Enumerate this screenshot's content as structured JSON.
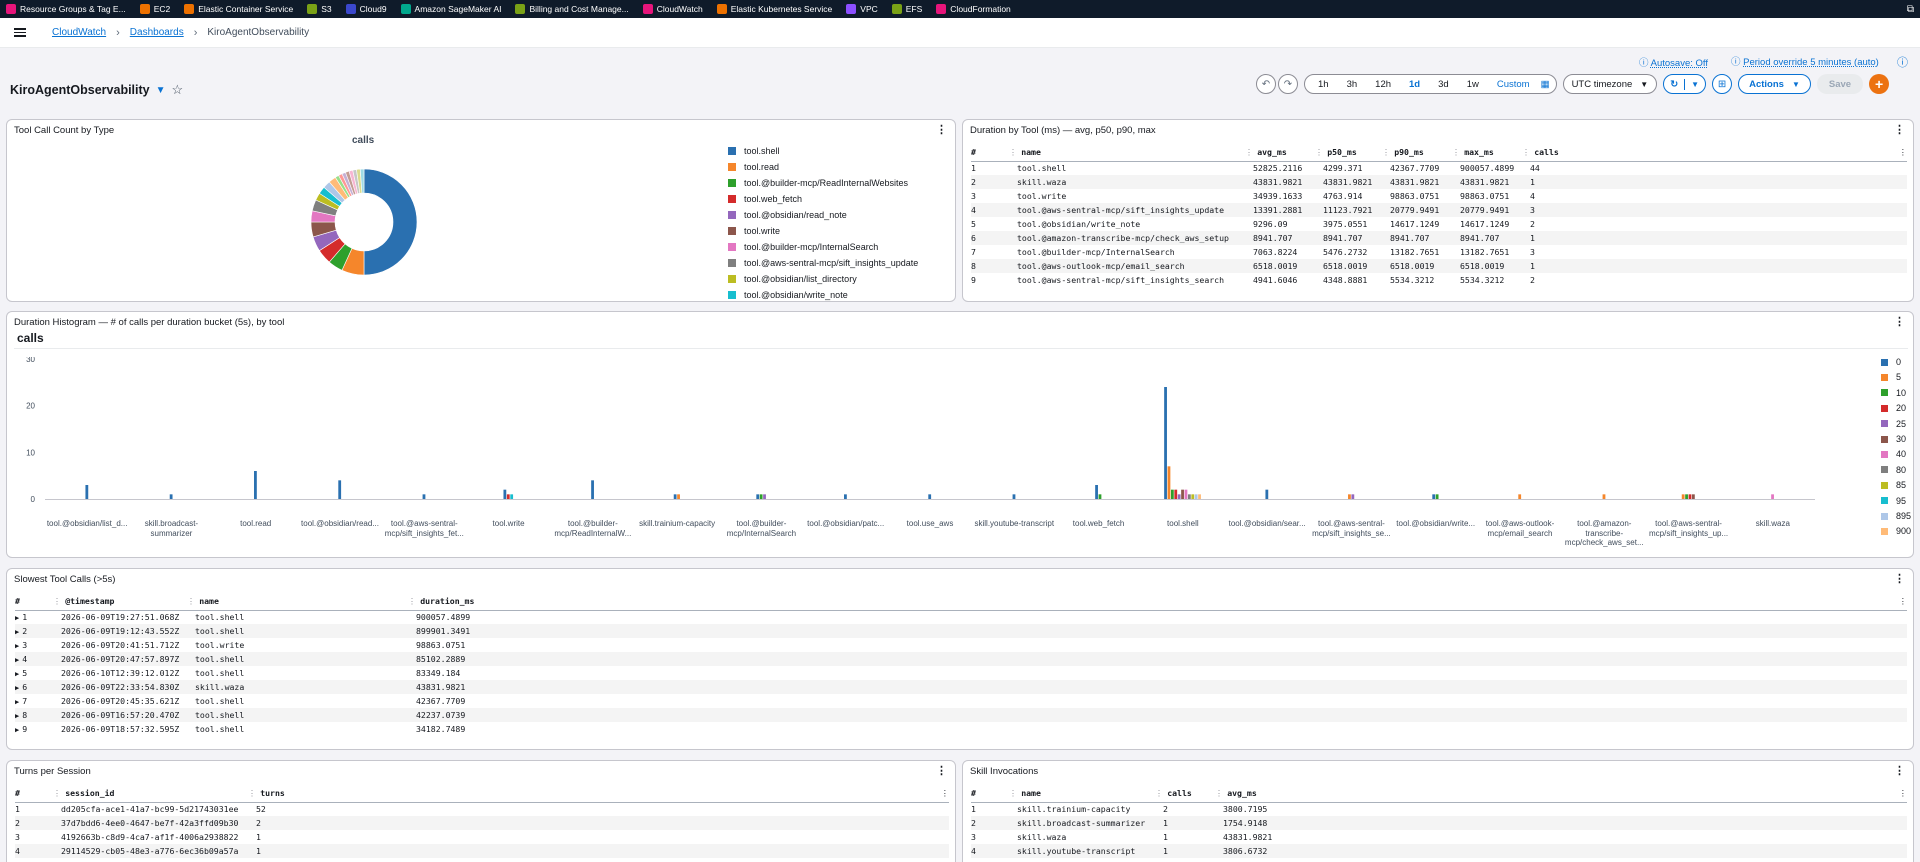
{
  "favorites": [
    {
      "label": "Resource Groups & Tag E...",
      "color": "#e7157b"
    },
    {
      "label": "EC2",
      "color": "#ed7100"
    },
    {
      "label": "Elastic Container Service",
      "color": "#ed7100"
    },
    {
      "label": "S3",
      "color": "#7aa116"
    },
    {
      "label": "Cloud9",
      "color": "#3b48cc"
    },
    {
      "label": "Amazon SageMaker AI",
      "color": "#01a88d"
    },
    {
      "label": "Billing and Cost Manage...",
      "color": "#7aa116"
    },
    {
      "label": "CloudWatch",
      "color": "#e7157b"
    },
    {
      "label": "Elastic Kubernetes Service",
      "color": "#ed7100"
    },
    {
      "label": "VPC",
      "color": "#8c4fff"
    },
    {
      "label": "EFS",
      "color": "#7aa116"
    },
    {
      "label": "CloudFormation",
      "color": "#e7157b"
    }
  ],
  "breadcrumb": {
    "root": "CloudWatch",
    "section": "Dashboards",
    "current": "KiroAgentObservability"
  },
  "top": {
    "autosave": "Autosave: Off",
    "period": "Period override 5 minutes (auto)"
  },
  "dashboard": {
    "title": "KiroAgentObservability"
  },
  "toolbar": {
    "ranges": [
      "1h",
      "3h",
      "12h",
      "1d",
      "3d",
      "1w"
    ],
    "active_range": "1d",
    "custom": "Custom",
    "timezone": "UTC timezone",
    "actions": "Actions",
    "save": "Save"
  },
  "w1": {
    "title": "Tool Call Count by Type",
    "chart_title": "calls"
  },
  "chart_data": [
    {
      "type": "pie",
      "title": "calls",
      "legend": [
        "tool.shell",
        "tool.read",
        "tool.@builder-mcp/ReadInternalWebsites",
        "tool.web_fetch",
        "tool.@obsidian/read_note",
        "tool.write",
        "tool.@builder-mcp/InternalSearch",
        "tool.@aws-sentral-mcp/sift_insights_update",
        "tool.@obsidian/list_directory",
        "tool.@obsidian/write_note"
      ],
      "colors": [
        "#2a70b0",
        "#f5862b",
        "#2ea02c",
        "#d42b2b",
        "#9467bd",
        "#8c564b",
        "#e377c2",
        "#7f7f7f",
        "#bcbd22",
        "#17becf"
      ],
      "extra_colors": [
        "#aec7e8",
        "#ffbb78",
        "#98df8a",
        "#ff9896",
        "#c5b0d5",
        "#c49c94",
        "#f7b6d2",
        "#c7c7c7",
        "#dbdb8d",
        "#9edae5"
      ],
      "values": [
        44,
        6,
        4,
        4,
        4,
        4,
        3,
        3,
        2,
        2
      ],
      "extra_values": [
        2,
        2,
        1,
        1,
        1,
        1,
        1,
        1,
        1,
        1
      ]
    },
    {
      "type": "bar",
      "title": "calls",
      "categories": [
        "tool.@obsidian/list_d...",
        "skill.broadcast-summarizer",
        "tool.read",
        "tool.@obsidian/read...",
        "tool.@aws-sentral-mcp/sift_insights_fet...",
        "tool.write",
        "tool.@builder-mcp/ReadInternalW...",
        "skill.trainium-capacity",
        "tool.@builder-mcp/InternalSearch",
        "tool.@obsidian/patc...",
        "tool.use_aws",
        "skill.youtube-transcript",
        "tool.web_fetch",
        "tool.shell",
        "tool.@obsidian/sear...",
        "tool.@aws-sentral-mcp/sift_insights_se...",
        "tool.@obsidian/write...",
        "tool.@aws-outlook-mcp/email_search",
        "tool.@amazon-transcribe-mcp/check_aws_set...",
        "tool.@aws-sentral-mcp/sift_insights_up...",
        "skill.waza"
      ],
      "series": [
        {
          "name": "0",
          "color": "#2a70b0",
          "values": [
            3,
            1,
            6,
            4,
            1,
            2,
            4,
            1,
            1,
            1,
            1,
            1,
            3,
            24,
            2,
            0,
            1,
            0,
            0,
            0,
            0
          ]
        },
        {
          "name": "5",
          "color": "#f5862b",
          "values": [
            0,
            0,
            0,
            0,
            0,
            0,
            0,
            1,
            0,
            0,
            0,
            0,
            0,
            7,
            0,
            1,
            0,
            1,
            1,
            1,
            0
          ]
        },
        {
          "name": "10",
          "color": "#2ea02c",
          "values": [
            0,
            0,
            0,
            0,
            0,
            0,
            0,
            0,
            1,
            0,
            0,
            0,
            1,
            2,
            0,
            0,
            1,
            0,
            0,
            1,
            0
          ]
        },
        {
          "name": "20",
          "color": "#d42b2b",
          "values": [
            0,
            0,
            0,
            0,
            0,
            1,
            0,
            0,
            0,
            0,
            0,
            0,
            0,
            2,
            0,
            0,
            0,
            0,
            0,
            1,
            0
          ]
        },
        {
          "name": "25",
          "color": "#9467bd",
          "values": [
            0,
            0,
            0,
            0,
            0,
            0,
            0,
            0,
            1,
            0,
            0,
            0,
            0,
            1,
            0,
            1,
            0,
            0,
            0,
            0,
            0
          ]
        },
        {
          "name": "30",
          "color": "#8c564b",
          "values": [
            0,
            0,
            0,
            0,
            0,
            0,
            0,
            0,
            0,
            0,
            0,
            0,
            0,
            2,
            0,
            0,
            0,
            0,
            0,
            1,
            0
          ]
        },
        {
          "name": "40",
          "color": "#e377c2",
          "values": [
            0,
            0,
            0,
            0,
            0,
            0,
            0,
            0,
            0,
            0,
            0,
            0,
            0,
            2,
            0,
            0,
            0,
            0,
            0,
            0,
            1
          ]
        },
        {
          "name": "80",
          "color": "#7f7f7f",
          "values": [
            0,
            0,
            0,
            0,
            0,
            0,
            0,
            0,
            0,
            0,
            0,
            0,
            0,
            1,
            0,
            0,
            0,
            0,
            0,
            0,
            0
          ]
        },
        {
          "name": "85",
          "color": "#bcbd22",
          "values": [
            0,
            0,
            0,
            0,
            0,
            0,
            0,
            0,
            0,
            0,
            0,
            0,
            0,
            1,
            0,
            0,
            0,
            0,
            0,
            0,
            0
          ]
        },
        {
          "name": "95",
          "color": "#17becf",
          "values": [
            0,
            0,
            0,
            0,
            0,
            1,
            0,
            0,
            0,
            0,
            0,
            0,
            0,
            0,
            0,
            0,
            0,
            0,
            0,
            0,
            0
          ]
        },
        {
          "name": "895",
          "color": "#aec7e8",
          "values": [
            0,
            0,
            0,
            0,
            0,
            0,
            0,
            0,
            0,
            0,
            0,
            0,
            0,
            1,
            0,
            0,
            0,
            0,
            0,
            0,
            0
          ]
        },
        {
          "name": "900",
          "color": "#ffbb78",
          "values": [
            0,
            0,
            0,
            0,
            0,
            0,
            0,
            0,
            0,
            0,
            0,
            0,
            0,
            1,
            0,
            0,
            0,
            0,
            0,
            0,
            0
          ]
        }
      ],
      "ylim": [
        0,
        30
      ],
      "yticks": [
        0,
        10,
        20,
        30
      ]
    }
  ],
  "w2": {
    "title": "Duration by Tool (ms) — avg, p50, p90, max",
    "headers": [
      "#",
      "name",
      "avg_ms",
      "p50_ms",
      "p90_ms",
      "max_ms",
      "calls"
    ],
    "rows": [
      [
        "1",
        "tool.shell",
        "52825.2116",
        "4299.371",
        "42367.7709",
        "900057.4899",
        "44"
      ],
      [
        "2",
        "skill.waza",
        "43831.9821",
        "43831.9821",
        "43831.9821",
        "43831.9821",
        "1"
      ],
      [
        "3",
        "tool.write",
        "34939.1633",
        "4763.914",
        "98863.0751",
        "98863.0751",
        "4"
      ],
      [
        "4",
        "tool.@aws-sentral-mcp/sift_insights_update",
        "13391.2881",
        "11123.7921",
        "20779.9491",
        "20779.9491",
        "3"
      ],
      [
        "5",
        "tool.@obsidian/write_note",
        "9296.09",
        "3975.0551",
        "14617.1249",
        "14617.1249",
        "2"
      ],
      [
        "6",
        "tool.@amazon-transcribe-mcp/check_aws_setup",
        "8941.707",
        "8941.707",
        "8941.707",
        "8941.707",
        "1"
      ],
      [
        "7",
        "tool.@builder-mcp/InternalSearch",
        "7063.8224",
        "5476.2732",
        "13182.7651",
        "13182.7651",
        "3"
      ],
      [
        "8",
        "tool.@aws-outlook-mcp/email_search",
        "6518.0019",
        "6518.0019",
        "6518.0019",
        "6518.0019",
        "1"
      ],
      [
        "9",
        "tool.@aws-sentral-mcp/sift_insights_search",
        "4941.6046",
        "4348.8881",
        "5534.3212",
        "5534.3212",
        "2"
      ]
    ]
  },
  "w3": {
    "title": "Duration Histogram — # of calls per duration bucket (5s), by tool",
    "chart_title": "calls"
  },
  "w4": {
    "title": "Slowest Tool Calls (>5s)",
    "headers": [
      "#",
      "@timestamp",
      "name",
      "duration_ms"
    ],
    "rows": [
      [
        "1",
        "2026-06-09T19:27:51.068Z",
        "tool.shell",
        "900057.4899"
      ],
      [
        "2",
        "2026-06-09T19:12:43.552Z",
        "tool.shell",
        "899901.3491"
      ],
      [
        "3",
        "2026-06-09T20:41:51.712Z",
        "tool.write",
        "98863.0751"
      ],
      [
        "4",
        "2026-06-09T20:47:57.897Z",
        "tool.shell",
        "85102.2889"
      ],
      [
        "5",
        "2026-06-10T12:39:12.012Z",
        "tool.shell",
        "83349.184"
      ],
      [
        "6",
        "2026-06-09T22:33:54.830Z",
        "skill.waza",
        "43831.9821"
      ],
      [
        "7",
        "2026-06-09T20:45:35.621Z",
        "tool.shell",
        "42367.7709"
      ],
      [
        "8",
        "2026-06-09T16:57:20.470Z",
        "tool.shell",
        "42237.0739"
      ],
      [
        "9",
        "2026-06-09T18:57:32.595Z",
        "tool.shell",
        "34182.7489"
      ]
    ]
  },
  "w5": {
    "title": "Turns per Session",
    "headers": [
      "#",
      "session_id",
      "turns"
    ],
    "rows": [
      [
        "1",
        "dd205cfa-ace1-41a7-bc99-5d21743031ee",
        "52"
      ],
      [
        "2",
        "37d7bdd6-4ee0-4647-be7f-42a3ffd09b30",
        "2"
      ],
      [
        "3",
        "4192663b-c8d9-4ca7-af1f-4006a2938822",
        "1"
      ],
      [
        "4",
        "29114529-cb05-48e3-a776-6ec36b09a57a",
        "1"
      ]
    ]
  },
  "w6": {
    "title": "Skill Invocations",
    "headers": [
      "#",
      "name",
      "calls",
      "avg_ms"
    ],
    "rows": [
      [
        "1",
        "skill.trainium-capacity",
        "2",
        "3800.7195"
      ],
      [
        "2",
        "skill.broadcast-summarizer",
        "1",
        "1754.9148"
      ],
      [
        "3",
        "skill.waza",
        "1",
        "43831.9821"
      ],
      [
        "4",
        "skill.youtube-transcript",
        "1",
        "3806.6732"
      ]
    ]
  }
}
